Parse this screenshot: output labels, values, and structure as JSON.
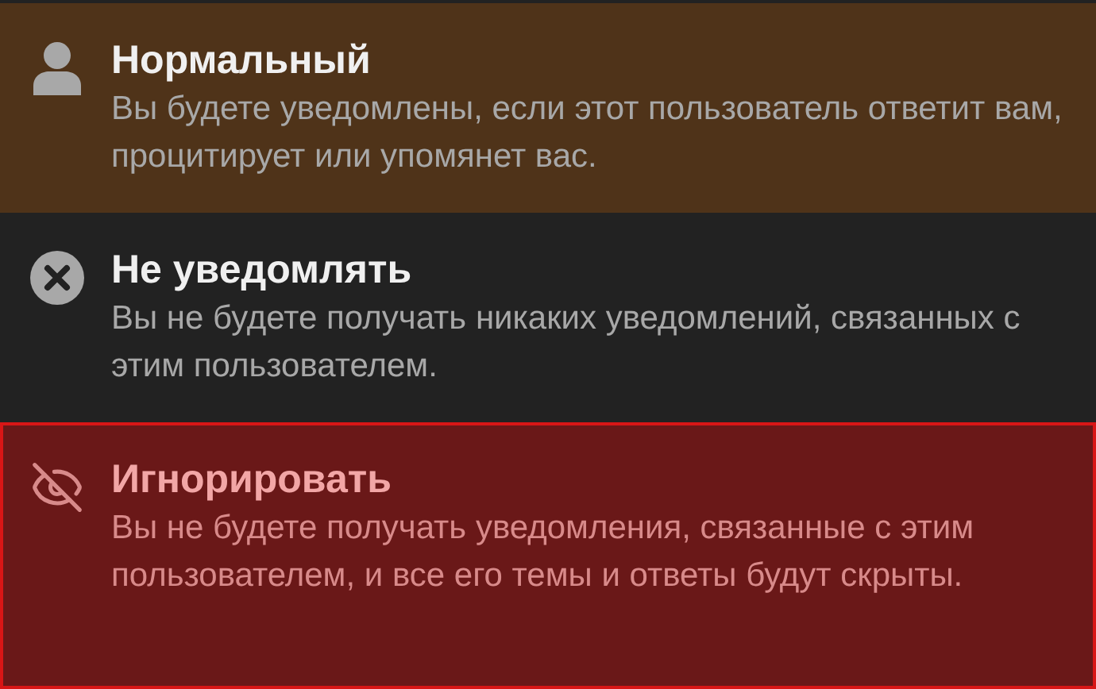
{
  "options": [
    {
      "kind": "normal",
      "title": "Нормальный",
      "description": "Вы будете уведомлены, если этот пользователь ответит вам, процитирует или упомянет вас.",
      "focused": true,
      "selected": false
    },
    {
      "kind": "mute",
      "title": "Не уведомлять",
      "description": "Вы не будете получать никаких уведомлений, связанных с этим пользователем.",
      "focused": false,
      "selected": false
    },
    {
      "kind": "ignore",
      "title": "Игнорировать",
      "description": "Вы не будете получать уведомления, связанные с этим пользователем, и все его темы и ответы будут скрыты.",
      "focused": false,
      "selected": true
    }
  ]
}
